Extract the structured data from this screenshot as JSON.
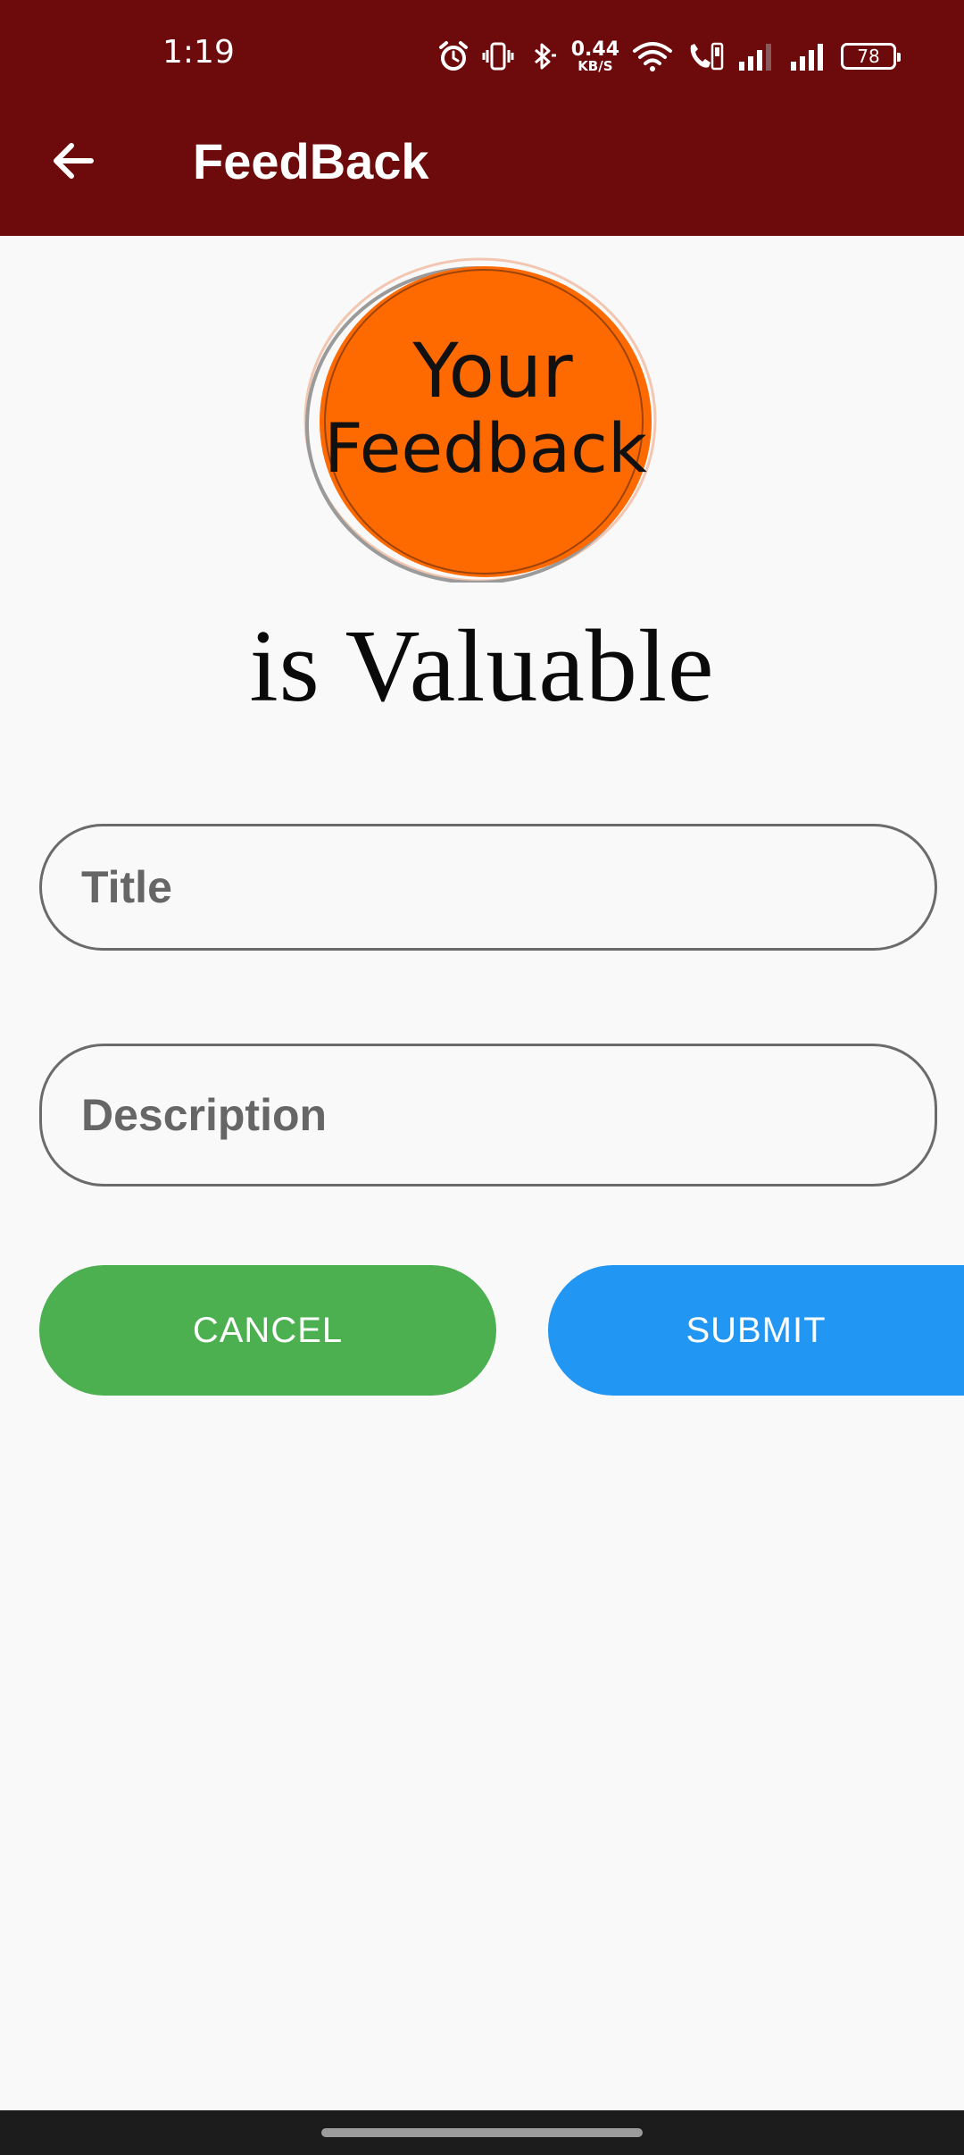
{
  "status_bar": {
    "time": "1:19",
    "net_speed_value": "0.44",
    "net_speed_unit": "KB/S",
    "battery": "78",
    "icons": [
      "alarm-icon",
      "vibrate-icon",
      "bluetooth-icon",
      "wifi-icon",
      "volte-call-icon",
      "signal-icon-sim1",
      "signal-icon-sim2",
      "battery-icon"
    ]
  },
  "app_bar": {
    "back_icon": "arrow-left-icon",
    "title": "FeedBack",
    "background": "#6d0a0b"
  },
  "hero": {
    "logo_line1": "Your",
    "logo_line2": "Feedback",
    "logo_color": "#ff6a00",
    "tagline": "is Valuable"
  },
  "form": {
    "title_placeholder": "Title",
    "title_value": "",
    "description_placeholder": "Description",
    "description_value": ""
  },
  "actions": {
    "cancel_label": "CANCEL",
    "cancel_color": "#4caf50",
    "submit_label": "SUBMIT",
    "submit_color": "#2196f3"
  }
}
